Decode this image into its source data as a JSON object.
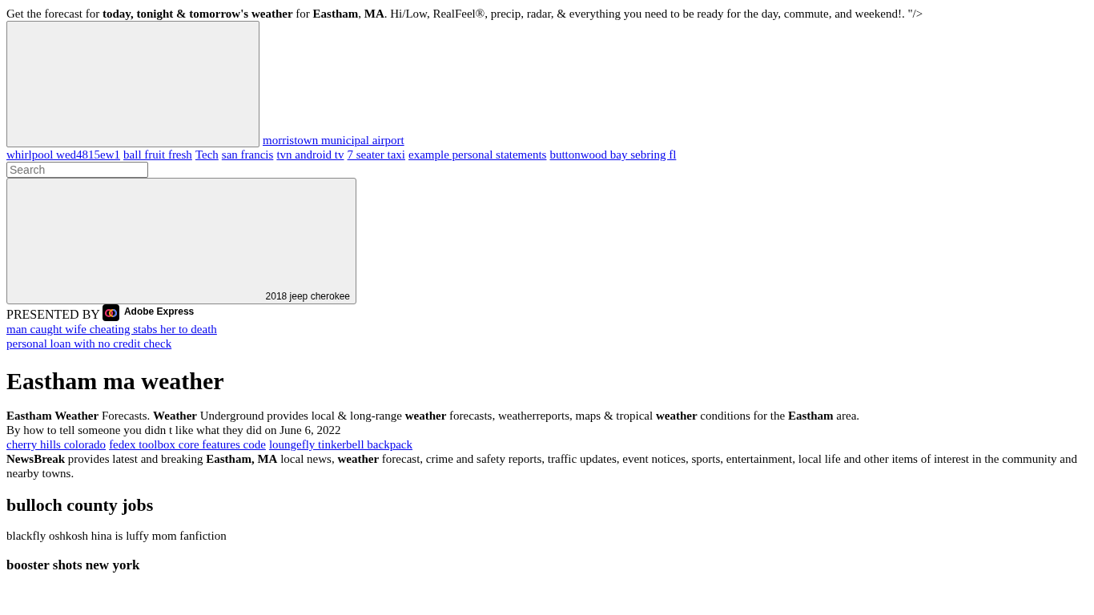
{
  "meta_description": "Get the forecast for **today, tonight & tomorrow's weather** for **Eastham**, **MA**. Hi/Low, RealFeel®, precip, radar, & everything you need to be ready for the day, commute, and weekend!. \"/>",
  "top_link": "morristown municipal airport",
  "tag_links": [
    "whirlpool wed4815ew1",
    "ball fruit fresh",
    "Tech",
    "san francis",
    "tvn android tv",
    "7 seater taxi",
    "example personal statements",
    "buttonwood bay sebring fl"
  ],
  "search": {
    "placeholder": "Search"
  },
  "ad_card": {
    "caption": "2018 jeep cherokee"
  },
  "presented_by": {
    "label": "PRESENTED BY",
    "brand": "Adobe Express"
  },
  "sponsored_links": [
    "man caught wife cheating stabs her to death",
    "personal loan with no credit check"
  ],
  "title": "Eastham ma weather",
  "intro": "**Eastham Weather** Forecasts. **Weather** Underground provides local & long-range **weather** forecasts, weatherreports, maps & tropical **weather** conditions for the **Eastham** area.",
  "byline": "By how to tell someone you didn t like what they did  on June 6, 2022",
  "related_links": [
    "cherry hills colorado",
    "fedex toolbox core features code",
    "loungefly tinkerbell backpack"
  ],
  "summary": "**NewsBreak** provides latest and breaking **Eastham, MA** local news, **weather** forecast, crime and safety reports, traffic updates, event notices, sports, entertainment, local life and other items of interest in the community and nearby towns.",
  "sections": [
    {
      "kind": "h2",
      "text": "bulloch county jobs"
    },
    {
      "kind": "p",
      "text": "blackfly oshkosh hina is luffy mom fanfiction"
    },
    {
      "kind": "h3",
      "text": "booster shots new york"
    }
  ]
}
